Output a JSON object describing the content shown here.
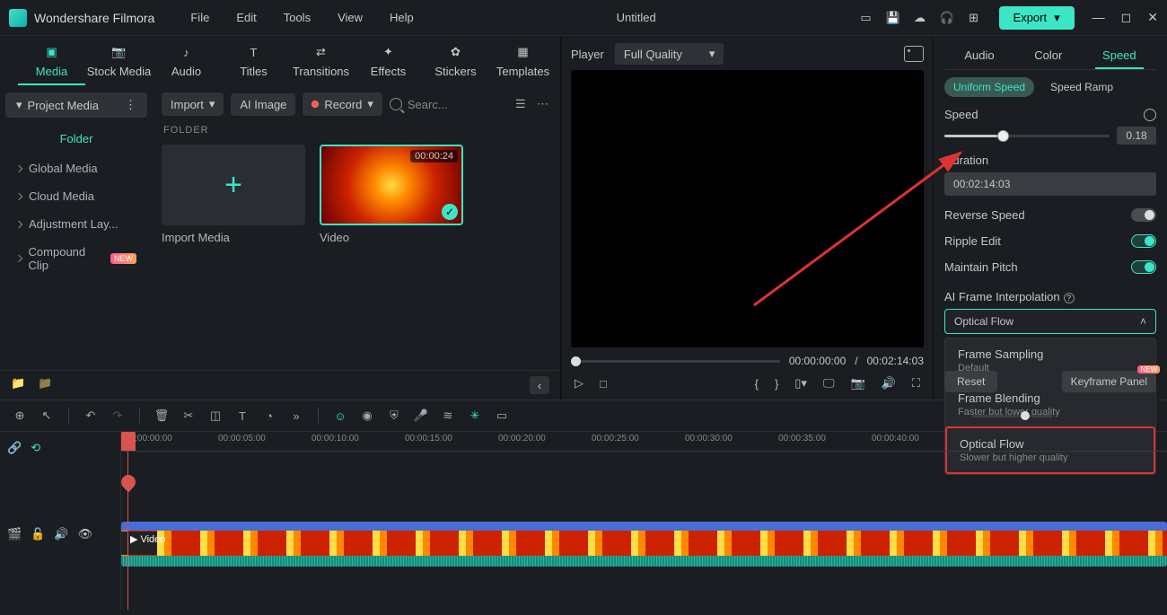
{
  "app": {
    "name": "Wondershare Filmora",
    "doc_title": "Untitled"
  },
  "menu": [
    "File",
    "Edit",
    "Tools",
    "View",
    "Help"
  ],
  "export_label": "Export",
  "top_tabs": [
    {
      "label": "Media",
      "active": true
    },
    {
      "label": "Stock Media"
    },
    {
      "label": "Audio"
    },
    {
      "label": "Titles"
    },
    {
      "label": "Transitions"
    },
    {
      "label": "Effects"
    },
    {
      "label": "Stickers"
    },
    {
      "label": "Templates"
    }
  ],
  "sidebar": {
    "pill": "Project Media",
    "folder_label": "Folder",
    "items": [
      {
        "label": "Global Media"
      },
      {
        "label": "Cloud Media"
      },
      {
        "label": "Adjustment Lay..."
      },
      {
        "label": "Compound Clip",
        "new": true
      }
    ]
  },
  "content_toolbar": {
    "import": "Import",
    "ai_image": "AI Image",
    "record": "Record",
    "search_placeholder": "Searc..."
  },
  "folder_hdr": "FOLDER",
  "media_cards": [
    {
      "label": "Import Media",
      "type": "import"
    },
    {
      "label": "Video",
      "type": "video",
      "duration": "00:00:24"
    }
  ],
  "preview": {
    "player_label": "Player",
    "quality": "Full Quality",
    "current": "00:00:00:00",
    "sep": "/",
    "total": "00:02:14:03"
  },
  "props": {
    "tabs": [
      "Audio",
      "Color",
      "Speed"
    ],
    "active_tab": "Speed",
    "subtabs": [
      "Uniform Speed",
      "Speed Ramp"
    ],
    "active_sub": "Uniform Speed",
    "speed_label": "Speed",
    "speed_value": "0.18",
    "duration_label": "Duration",
    "duration_value": "00:02:14:03",
    "reverse_label": "Reverse Speed",
    "ripple_label": "Ripple Edit",
    "pitch_label": "Maintain Pitch",
    "interp_label": "AI Frame Interpolation",
    "interp_value": "Optical Flow",
    "interp_options": [
      {
        "title": "Frame Sampling",
        "sub": "Default"
      },
      {
        "title": "Frame Blending",
        "sub": "Faster but lower quality"
      },
      {
        "title": "Optical Flow",
        "sub": "Slower but higher quality",
        "hl": true
      }
    ],
    "reset": "Reset",
    "keyframe": "Keyframe Panel",
    "new_tag": "NEW"
  },
  "timeline": {
    "ruler": [
      "00:00:00:00",
      "00:00:05:00",
      "00:00:10:00",
      "00:00:15:00",
      "00:00:20:00",
      "00:00:25:00",
      "00:00:30:00",
      "00:00:35:00",
      "00:00:40:00"
    ],
    "clip_label": "Video"
  }
}
